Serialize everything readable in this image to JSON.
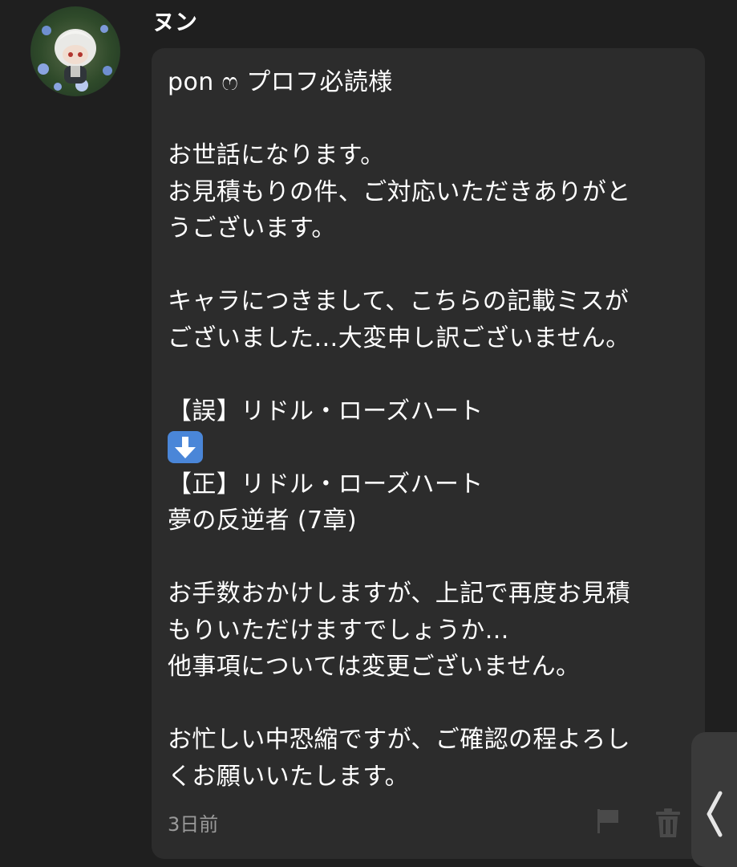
{
  "message": {
    "sender_name": "ヌン",
    "avatar_icon": "user-avatar-icon",
    "lines": [
      "pon ෆ プロフ必読様",
      "",
      "お世話になります。",
      "お見積もりの件、ご対応いただきありがと",
      "うございます。",
      "",
      "キャラにつきまして、こちらの記載ミスが",
      "ございました…大変申し訳ございません。",
      "",
      "【誤】リドル・ローズハート",
      "",
      "【正】リドル・ローズハート",
      "夢の反逆者 (7章)",
      "",
      "お手数おかけしますが、上記で再度お見積",
      "もりいただけますでしょうか…",
      "他事項については変更ございません。",
      "",
      "お忙しい中恐縮ですが、ご確認の程よろし",
      "くお願いいたします。"
    ],
    "arrow_emoji": "down-arrow-emoji",
    "timestamp": "3日前"
  },
  "actions": {
    "flag_icon": "flag-icon",
    "trash_icon": "trash-icon",
    "side_tab_icon": "chevron-left-icon"
  },
  "colors": {
    "background": "#1f1f1f",
    "bubble": "#2c2c2c",
    "text": "#ffffff",
    "muted": "#9a9a9a",
    "emoji_blue": "#4a86d8"
  }
}
